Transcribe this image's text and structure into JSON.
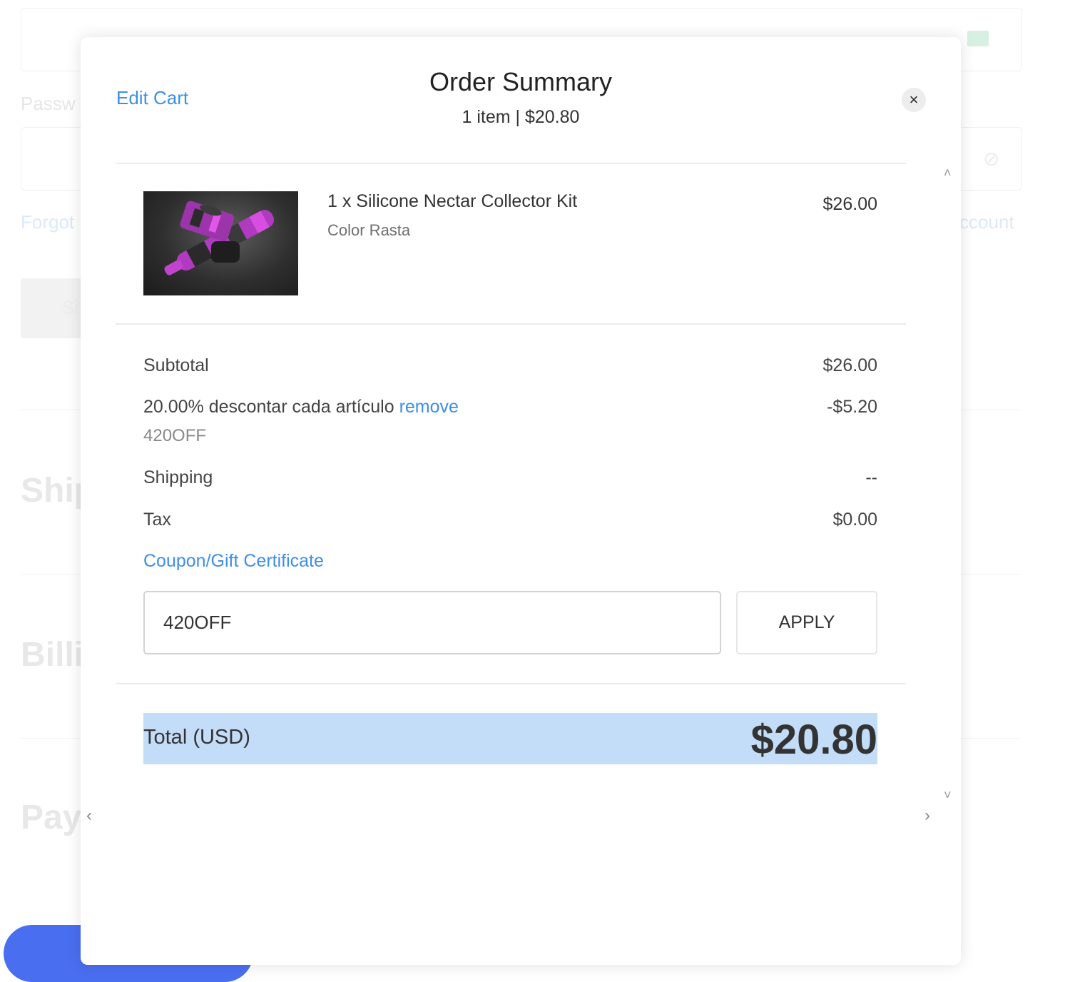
{
  "background": {
    "password_label": "Passw",
    "forgot_link": "Forgot",
    "account_link": "ccount",
    "sign_in_button": "Si",
    "shipping_heading": "Ship",
    "billing_heading": "Billi",
    "payment_heading": "Pay"
  },
  "modal": {
    "edit_cart": "Edit Cart",
    "title": "Order Summary",
    "subtitle": "1 item | $20.80",
    "close": "×",
    "item": {
      "name": "1 x Silicone Nectar Collector Kit",
      "option": "Color Rasta",
      "price": "$26.00"
    },
    "summary": {
      "subtotal_label": "Subtotal",
      "subtotal_value": "$26.00",
      "discount_label": "20.00% descontar cada artículo",
      "discount_remove": "remove",
      "discount_value": "-$5.20",
      "discount_code": "420OFF",
      "shipping_label": "Shipping",
      "shipping_value": "--",
      "tax_label": "Tax",
      "tax_value": "$0.00"
    },
    "coupon": {
      "link": "Coupon/Gift Certificate",
      "input_value": "420OFF",
      "apply_label": "APPLY"
    },
    "total": {
      "label": "Total (USD)",
      "value": "$20.80"
    }
  },
  "colors": {
    "link": "#3e8ee8",
    "total_highlight": "#c3dcf8",
    "pay_button": "#4a6ef0"
  },
  "icons": {
    "close": "close-icon",
    "scroll_up": "chevron-up-icon",
    "scroll_down": "chevron-down-icon",
    "prev": "chevron-left-icon",
    "next": "chevron-right-icon",
    "mail": "mail-icon",
    "eye": "eye-off-icon"
  }
}
